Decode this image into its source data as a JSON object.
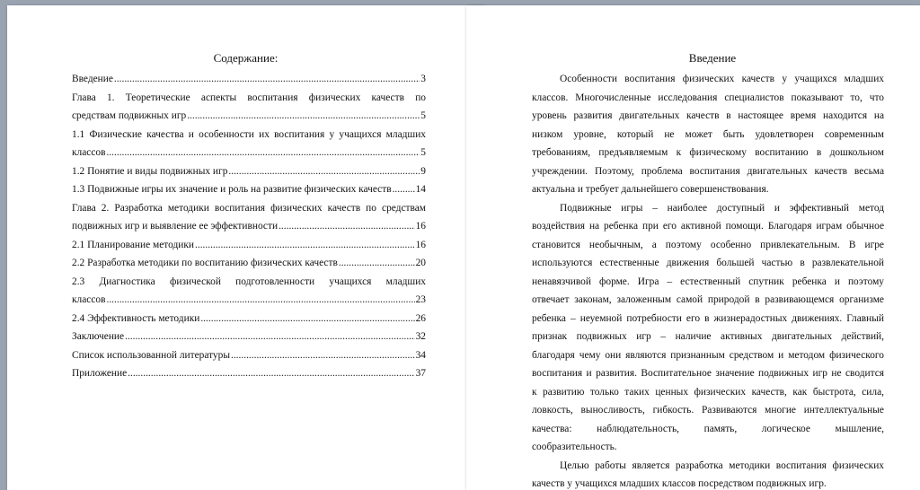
{
  "toc": {
    "title": "Содержание:",
    "entries": [
      {
        "text": "Введение",
        "page": "3"
      },
      {
        "text": "Глава 1.   Теоретические аспекты воспитания физических качеств по"
      },
      {
        "text": "средствам подвижных игр",
        "page": "5"
      },
      {
        "text": "1.1 Физические качества и особенности их воспитания у учащихся младших"
      },
      {
        "text": "классов",
        "page": "5"
      },
      {
        "text": "1.2 Понятие и виды подвижных игр",
        "page": "9"
      },
      {
        "text": "1.3 Подвижные игры их значение и роль на развитие физических качеств",
        "page": "14"
      },
      {
        "text": "Глава 2. Разработка методики воспитания физических качеств по средствам"
      },
      {
        "text": "подвижных игр и выявление ее эффективности",
        "page": "16"
      },
      {
        "text": "2.1 Планирование методики",
        "page": "16"
      },
      {
        "text": "2.2 Разработка методики по воспитанию физических качеств",
        "page": "20"
      },
      {
        "text": "2.3   Диагностика   физической   подготовленности   учащихся   младших"
      },
      {
        "text": "классов",
        "page": "23"
      },
      {
        "text": "2.4 Эффективность методики",
        "page": "26"
      },
      {
        "text": "Заключение",
        "page": "32"
      },
      {
        "text": "Список использованной литературы",
        "page": "34"
      },
      {
        "text": "Приложение",
        "page": "37"
      }
    ]
  },
  "intro": {
    "title": "Введение",
    "lines": [
      {
        "t": "Особенности воспитания физических качеств у учащихся младших",
        "ind": true,
        "j": true
      },
      {
        "t": "классов. Многочисленные исследования специалистов показывают то, что",
        "j": true
      },
      {
        "t": "уровень развития двигательных качеств в настоящее время находится на",
        "j": true
      },
      {
        "t": "низком уровне, который не может быть удовлетворен современным",
        "j": true
      },
      {
        "t": "требованиям, предъявляемым к физическому воспитанию в дошкольном",
        "j": true
      },
      {
        "t": "учреждении. Поэтому, проблема воспитания двигательных качеств весьма",
        "j": true
      },
      {
        "t": "актуальна и требует дальнейшего совершенствования."
      },
      {
        "t": "Подвижные игры – наиболее доступный и эффективный метод",
        "ind": true,
        "j": true
      },
      {
        "t": "воздействия на ребенка при его активной помощи. Благодаря играм обычное",
        "j": true
      },
      {
        "t": "становится необычным, а поэтому особенно привлекательным. В игре",
        "j": true
      },
      {
        "t": "используются естественные движения большей частью в развлекательной",
        "j": true
      },
      {
        "t": "ненавязчивой форме. Игра – естественный спутник ребенка и поэтому",
        "j": true
      },
      {
        "t": "отвечает законам, заложенным самой природой в развивающемся организме",
        "j": true
      },
      {
        "t": "ребенка – неуемной потребности его в жизнерадостных движениях. Главный",
        "j": true
      },
      {
        "t": "признак подвижных игр – наличие активных двигательных действий,",
        "j": true
      },
      {
        "t": "благодаря чему они являются признанным средством и методом физического",
        "j": true
      },
      {
        "t": "воспитания и развития. Воспитательное значение подвижных игр не сводится",
        "j": true
      },
      {
        "t": "к развитию только таких ценных физических качеств, как быстрота, сила,",
        "j": true
      },
      {
        "t": "ловкость, выносливость, гибкость. Развиваются многие интеллектуальные",
        "j": true
      },
      {
        "t": "качества:   наблюдательность,   память,   логическое   мышление,",
        "j": true
      },
      {
        "t": "сообразительность."
      },
      {
        "t": "Целью работы является разработка методики воспитания физических",
        "ind": true,
        "j": true
      },
      {
        "t": "качеств у учащихся младших классов посредством подвижных игр."
      }
    ]
  }
}
